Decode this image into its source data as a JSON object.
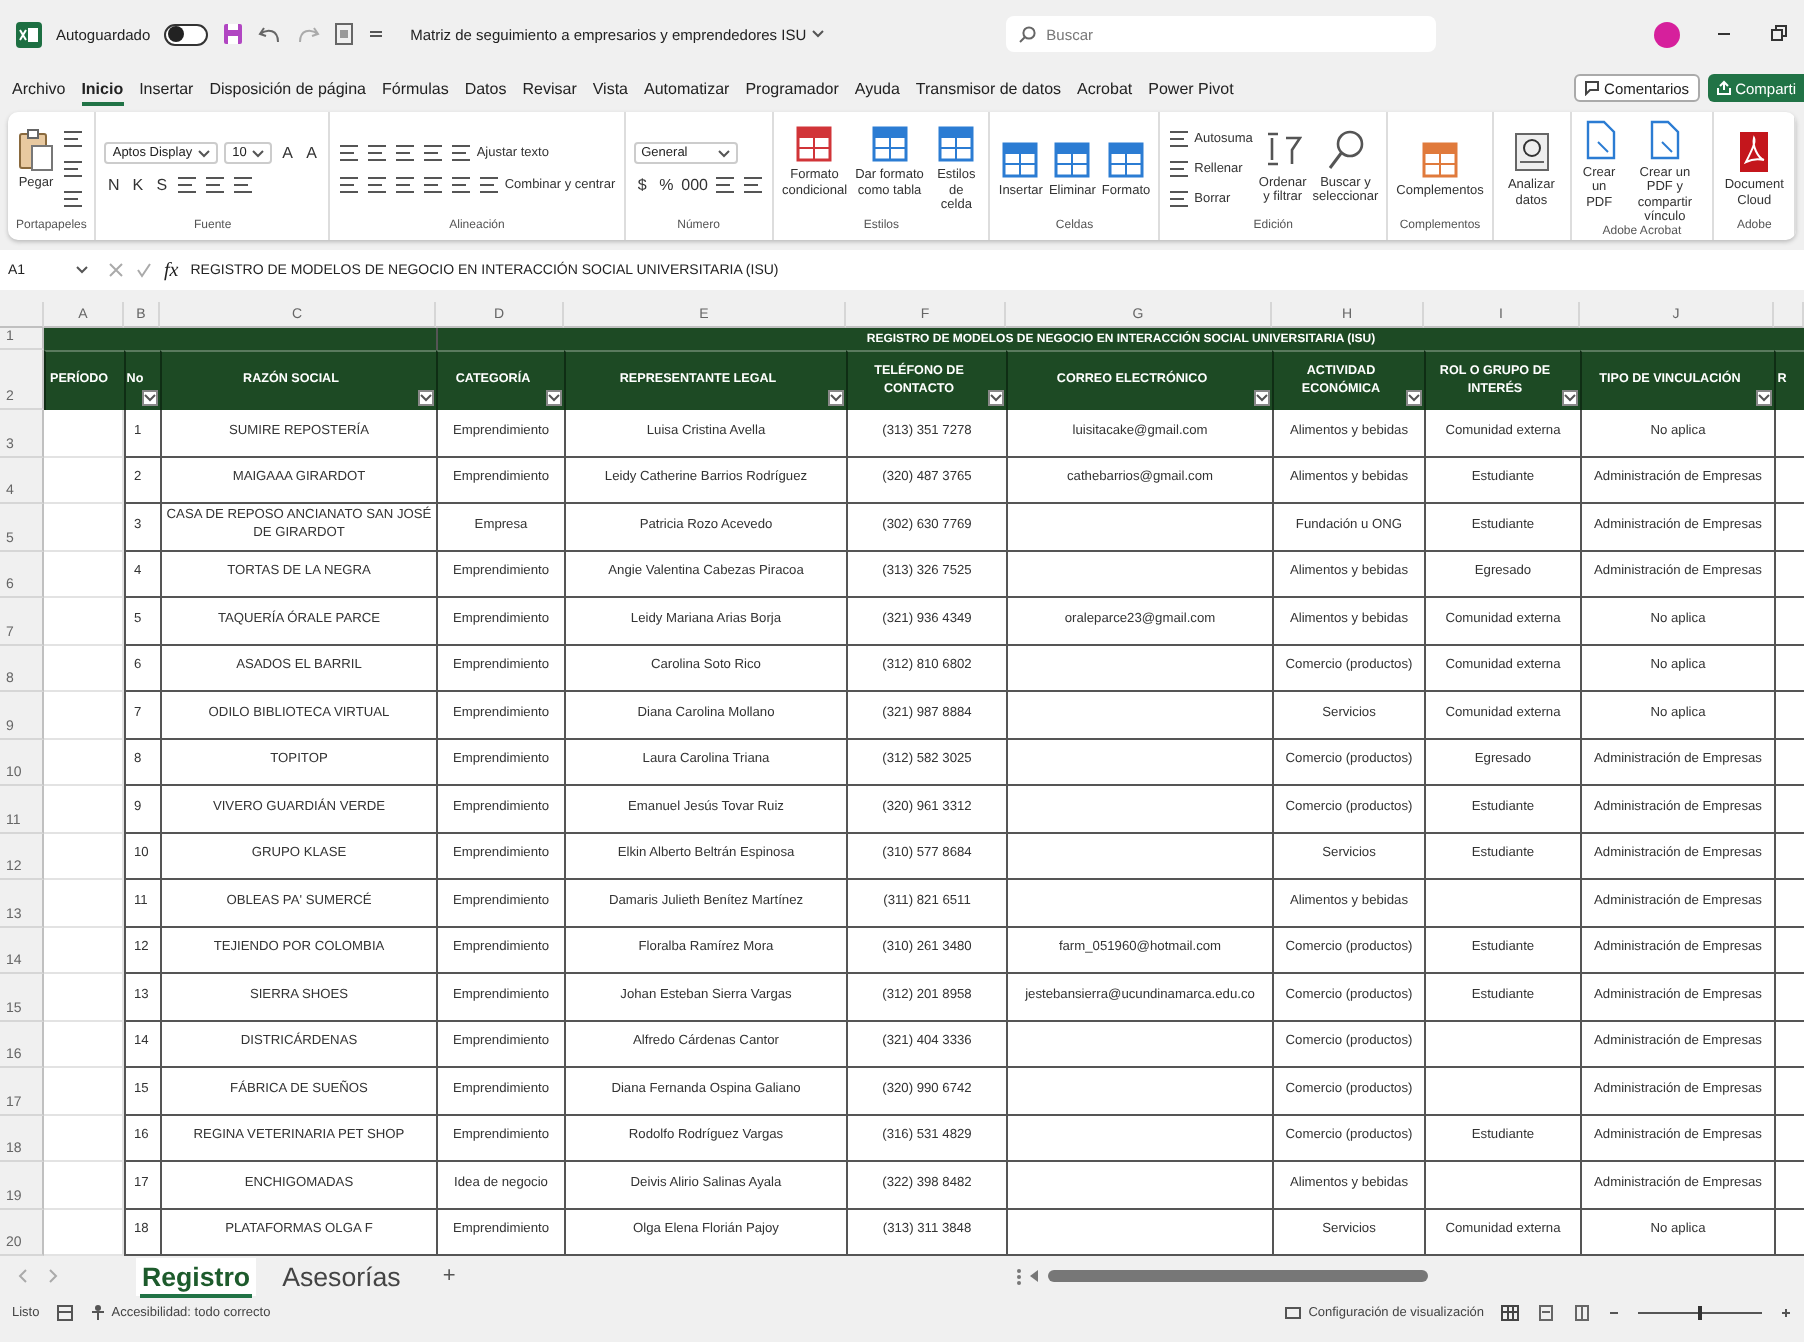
{
  "title_bar": {
    "autosave_label": "Autoguardado",
    "autosave_on": false,
    "document_title": "Matriz de seguimiento a empresarios y emprendedores ISU",
    "search_placeholder": "Buscar"
  },
  "menu_tabs": [
    {
      "label": "Archivo",
      "selected": false
    },
    {
      "label": "Inicio",
      "selected": true
    },
    {
      "label": "Insertar",
      "selected": false
    },
    {
      "label": "Disposición de página",
      "selected": false
    },
    {
      "label": "Fórmulas",
      "selected": false
    },
    {
      "label": "Datos",
      "selected": false
    },
    {
      "label": "Revisar",
      "selected": false
    },
    {
      "label": "Vista",
      "selected": false
    },
    {
      "label": "Automatizar",
      "selected": false
    },
    {
      "label": "Programador",
      "selected": false
    },
    {
      "label": "Ayuda",
      "selected": false
    },
    {
      "label": "Transmisor de datos",
      "selected": false
    },
    {
      "label": "Acrobat",
      "selected": false
    },
    {
      "label": "Power Pivot",
      "selected": false
    }
  ],
  "menu_buttons": [
    {
      "label": "Comentarios",
      "kind": "outline"
    },
    {
      "label": "Comparti",
      "kind": "primary"
    }
  ],
  "ribbon": {
    "groups": [
      {
        "label": "Portapapeles",
        "lines": [
          {
            "items": [
              {
                "kind": "large",
                "label": "Pegar"
              },
              {
                "kind": "stack",
                "items": [
                  {
                    "kind": "icon"
                  },
                  {
                    "kind": "icon"
                  },
                  {
                    "kind": "icon"
                  }
                ]
              }
            ]
          }
        ]
      },
      {
        "label": "Fuente",
        "lines": [
          {
            "items": [
              {
                "kind": "combo",
                "value": "Aptos Display"
              },
              {
                "kind": "combo",
                "value": "10"
              },
              {
                "kind": "glyph",
                "label": "A"
              },
              {
                "kind": "glyph",
                "label": "A"
              }
            ]
          },
          {
            "items": [
              {
                "kind": "glyph",
                "label": "N"
              },
              {
                "kind": "glyph",
                "label": "K"
              },
              {
                "kind": "glyph",
                "label": "S"
              },
              {
                "kind": "icon"
              },
              {
                "kind": "icon"
              },
              {
                "kind": "icon"
              }
            ]
          }
        ]
      },
      {
        "label": "Alineación",
        "lines": [
          {
            "items": [
              {
                "kind": "icon"
              },
              {
                "kind": "icon"
              },
              {
                "kind": "icon"
              },
              {
                "kind": "icon"
              },
              {
                "kind": "small",
                "label": "Ajustar texto"
              }
            ]
          },
          {
            "items": [
              {
                "kind": "icon"
              },
              {
                "kind": "icon"
              },
              {
                "kind": "icon"
              },
              {
                "kind": "icon"
              },
              {
                "kind": "icon"
              },
              {
                "kind": "small",
                "label": "Combinar y centrar"
              }
            ]
          }
        ]
      },
      {
        "label": "Número",
        "lines": [
          {
            "items": [
              {
                "kind": "combo",
                "value": "General"
              }
            ]
          },
          {
            "items": [
              {
                "kind": "glyph",
                "label": "$"
              },
              {
                "kind": "glyph",
                "label": "%"
              },
              {
                "kind": "glyph",
                "label": "000"
              },
              {
                "kind": "icon"
              },
              {
                "kind": "icon"
              }
            ]
          }
        ]
      },
      {
        "label": "Estilos",
        "lines": [
          {
            "items": [
              {
                "kind": "large",
                "label": "Formato condicional"
              },
              {
                "kind": "large",
                "label": "Dar formato como tabla"
              },
              {
                "kind": "large",
                "label": "Estilos de celda"
              }
            ]
          }
        ]
      },
      {
        "label": "Celdas",
        "lines": [
          {
            "items": [
              {
                "kind": "large",
                "label": "Insertar"
              },
              {
                "kind": "large",
                "label": "Eliminar"
              },
              {
                "kind": "large",
                "label": "Formato"
              }
            ]
          }
        ]
      },
      {
        "label": "Edición",
        "lines": [
          {
            "items": [
              {
                "kind": "stack",
                "items": [
                  {
                    "kind": "small",
                    "label": "Autosuma"
                  },
                  {
                    "kind": "small",
                    "label": "Rellenar"
                  },
                  {
                    "kind": "small",
                    "label": "Borrar"
                  }
                ]
              },
              {
                "kind": "large",
                "label": "Ordenar y filtrar"
              },
              {
                "kind": "large",
                "label": "Buscar y seleccionar"
              }
            ]
          }
        ]
      },
      {
        "label": "Complementos",
        "lines": [
          {
            "items": [
              {
                "kind": "large",
                "label": "Complementos"
              }
            ]
          }
        ]
      },
      {
        "lines": [
          {
            "items": [
              {
                "kind": "large",
                "label": "Analizar datos"
              }
            ]
          }
        ]
      },
      {
        "label": "Adobe Acrobat",
        "lines": [
          {
            "items": [
              {
                "kind": "large",
                "label": "Crear un PDF"
              },
              {
                "kind": "large",
                "label": "Crear un PDF y compartir vínculo"
              }
            ]
          }
        ]
      },
      {
        "label": "Adobe",
        "lines": [
          {
            "items": [
              {
                "kind": "large",
                "label": "Document Cloud"
              }
            ]
          }
        ]
      }
    ]
  },
  "formula_bar": {
    "cell": "A1",
    "function_label": "fx",
    "content": "REGISTRO DE MODELOS DE NEGOCIO EN INTERACCIÓN SOCIAL UNIVERSITARIA (ISU)"
  },
  "sheet": {
    "column_letters": [
      "A",
      "B",
      "C",
      "D",
      "E",
      "F",
      "G",
      "H",
      "I",
      "J"
    ],
    "row_numbers": [
      "1",
      "2",
      "3",
      "4",
      "5",
      "6",
      "7",
      "8",
      "9",
      "10",
      "11",
      "12",
      "13",
      "14",
      "15",
      "16",
      "17",
      "18",
      "19",
      "20"
    ],
    "title": "REGISTRO DE MODELOS DE NEGOCIO EN INTERACCIÓN SOCIAL UNIVERSITARIA (ISU)",
    "headers": [
      {
        "label": "PERÍODO",
        "filter": false
      },
      {
        "label": "No",
        "filter": true
      },
      {
        "label": "RAZÓN SOCIAL",
        "filter": true
      },
      {
        "label": "CATEGORÍA",
        "filter": true
      },
      {
        "label": "REPRESENTANTE LEGAL",
        "filter": true
      },
      {
        "label": "TELÉFONO DE CONTACTO",
        "filter": true
      },
      {
        "label": "CORREO ELECTRÓNICO",
        "filter": true
      },
      {
        "label": "ACTIVIDAD ECONÓMICA",
        "filter": true
      },
      {
        "label": "ROL O GRUPO DE INTERÉS",
        "filter": true
      },
      {
        "label": "TIPO DE VINCULACIÓN",
        "filter": true
      },
      {
        "label": "R",
        "filter": false
      }
    ],
    "rows": [
      {
        "no": "1",
        "razon_social": "SUMIRE REPOSTERÍA",
        "categoria": "Emprendimiento",
        "representante": "Luisa Cristina Avella",
        "telefono": "(313) 351 7278",
        "correo": "luisitacake@gmail.com",
        "actividad": "Alimentos y bebidas",
        "rol": "Comunidad externa",
        "vinculacion": "No aplica"
      },
      {
        "no": "2",
        "razon_social": "MAIGAAA GIRARDOT",
        "categoria": "Emprendimiento",
        "representante": "Leidy Catherine Barrios Rodríguez",
        "telefono": "(320) 487 3765",
        "correo": "cathebarrios@gmail.com",
        "actividad": "Alimentos y bebidas",
        "rol": "Estudiante",
        "vinculacion": "Administración de Empresas"
      },
      {
        "no": "3",
        "razon_social": "CASA DE REPOSO ANCIANATO SAN JOSÉ DE GIRARDOT",
        "categoria": "Empresa",
        "representante": "Patricia Rozo Acevedo",
        "telefono": "(302) 630 7769",
        "actividad": "Fundación u ONG",
        "rol": "Estudiante",
        "vinculacion": "Administración de Empresas"
      },
      {
        "no": "4",
        "razon_social": "TORTAS DE LA NEGRA",
        "categoria": "Emprendimiento",
        "representante": "Angie Valentina Cabezas Piracoa",
        "telefono": "(313) 326 7525",
        "actividad": "Alimentos y bebidas",
        "rol": "Egresado",
        "vinculacion": "Administración de Empresas"
      },
      {
        "no": "5",
        "razon_social": "TAQUERÍA ÓRALE PARCE",
        "categoria": "Emprendimiento",
        "representante": "Leidy Mariana Arias Borja",
        "telefono": "(321) 936 4349",
        "correo": "oraleparce23@gmail.com",
        "actividad": "Alimentos y bebidas",
        "rol": "Comunidad externa",
        "vinculacion": "No aplica"
      },
      {
        "no": "6",
        "razon_social": "ASADOS EL BARRIL",
        "categoria": "Emprendimiento",
        "representante": "Carolina Soto Rico",
        "telefono": "(312) 810 6802",
        "actividad": "Comercio (productos)",
        "rol": "Comunidad externa",
        "vinculacion": "No aplica"
      },
      {
        "no": "7",
        "razon_social": "ODILO BIBLIOTECA VIRTUAL",
        "categoria": "Emprendimiento",
        "representante": "Diana Carolina Mollano",
        "telefono": "(321) 987 8884",
        "actividad": "Servicios",
        "rol": "Comunidad externa",
        "vinculacion": "No aplica"
      },
      {
        "no": "8",
        "razon_social": "TOPITOP",
        "categoria": "Emprendimiento",
        "representante": "Laura Carolina Triana",
        "telefono": "(312) 582 3025",
        "actividad": "Comercio (productos)",
        "rol": "Egresado",
        "vinculacion": "Administración de Empresas"
      },
      {
        "no": "9",
        "razon_social": "VIVERO GUARDIÁN VERDE",
        "categoria": "Emprendimiento",
        "representante": "Emanuel Jesús Tovar Ruiz",
        "telefono": "(320) 961 3312",
        "actividad": "Comercio (productos)",
        "rol": "Estudiante",
        "vinculacion": "Administración de Empresas"
      },
      {
        "no": "10",
        "razon_social": "GRUPO KLASE",
        "categoria": "Emprendimiento",
        "representante": "Elkin Alberto Beltrán Espinosa",
        "telefono": "(310) 577 8684",
        "actividad": "Servicios",
        "rol": "Estudiante",
        "vinculacion": "Administración de Empresas"
      },
      {
        "no": "11",
        "razon_social": "OBLEAS PA' SUMERCÉ",
        "categoria": "Emprendimiento",
        "representante": "Damaris Julieth Benítez Martínez",
        "telefono": "(311) 821 6511",
        "actividad": "Alimentos y bebidas",
        "vinculacion": "Administración de Empresas"
      },
      {
        "no": "12",
        "razon_social": "TEJIENDO POR COLOMBIA",
        "categoria": "Emprendimiento",
        "representante": "Floralba Ramírez Mora",
        "telefono": "(310) 261 3480",
        "correo": "farm_051960@hotmail.com",
        "actividad": "Comercio (productos)",
        "rol": "Estudiante",
        "vinculacion": "Administración de Empresas"
      },
      {
        "no": "13",
        "razon_social": "SIERRA SHOES",
        "categoria": "Emprendimiento",
        "representante": "Johan Esteban Sierra Vargas",
        "telefono": "(312) 201 8958",
        "correo": "jestebansierra@ucundinamarca.edu.co",
        "actividad": "Comercio (productos)",
        "rol": "Estudiante",
        "vinculacion": "Administración de Empresas"
      },
      {
        "no": "14",
        "razon_social": "DISTRICÁRDENAS",
        "categoria": "Emprendimiento",
        "representante": "Alfredo Cárdenas Cantor",
        "telefono": "(321) 404 3336",
        "actividad": "Comercio (productos)",
        "vinculacion": "Administración de Empresas"
      },
      {
        "no": "15",
        "razon_social": "FÁBRICA DE SUEÑOS",
        "categoria": "Emprendimiento",
        "representante": "Diana Fernanda Ospina Galiano",
        "telefono": "(320) 990 6742",
        "actividad": "Comercio (productos)",
        "vinculacion": "Administración de Empresas"
      },
      {
        "no": "16",
        "razon_social": "REGINA VETERINARIA PET SHOP",
        "categoria": "Emprendimiento",
        "representante": "Rodolfo Rodríguez Vargas",
        "telefono": "(316) 531 4829",
        "actividad": "Comercio (productos)",
        "rol": "Estudiante",
        "vinculacion": "Administración de Empresas"
      },
      {
        "no": "17",
        "razon_social": "ENCHIGOMADAS",
        "categoria": "Idea de negocio",
        "representante": "Deivis Alirio Salinas Ayala",
        "telefono": "(322) 398 8482",
        "actividad": "Alimentos y bebidas",
        "vinculacion": "Administración de Empresas"
      },
      {
        "no": "18",
        "razon_social": "PLATAFORMAS OLGA F",
        "categoria": "Emprendimiento",
        "representante": "Olga Elena Florián Pajoy",
        "telefono": "(313) 311 3848",
        "actividad": "Servicios",
        "rol": "Comunidad externa",
        "vinculacion": "No aplica"
      }
    ]
  },
  "sheet_tabs": [
    {
      "label": "Registro",
      "selected": true
    },
    {
      "label": "Asesorías",
      "selected": false
    }
  ],
  "add_sheet": "+",
  "status_bar": {
    "status": "Listo",
    "accessibility": "Accesibilidad: todo correcto",
    "display_settings": "Configuración de visualización",
    "zoom_slider": {
      "level": 0.5
    }
  }
}
